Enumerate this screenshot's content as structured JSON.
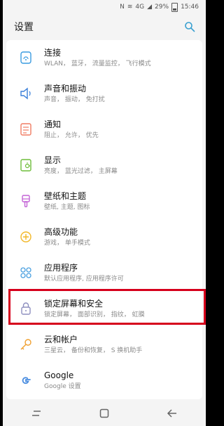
{
  "status": {
    "notif": "N",
    "signal": "4G",
    "battery": "29%",
    "time": "15:46"
  },
  "header": {
    "title": "设置"
  },
  "items": [
    {
      "label": "连接",
      "sub": "WLAN， 蓝牙， 流量监控， 飞行模式",
      "icon": "connection-icon",
      "color": "#3a9be0"
    },
    {
      "label": "声音和振动",
      "sub": "声音， 振动， 免打扰",
      "icon": "sound-icon",
      "color": "#3a7fd9"
    },
    {
      "label": "通知",
      "sub": "阻止， 允许， 优先",
      "icon": "notification-icon",
      "color": "#f07c62"
    },
    {
      "label": "显示",
      "sub": "亮度， 蓝光过滤， 主屏幕",
      "icon": "display-icon",
      "color": "#6ebd3b"
    },
    {
      "label": "壁纸和主题",
      "sub": "壁纸, 主题, 图标",
      "icon": "theme-icon",
      "color": "#c363d6"
    },
    {
      "label": "高级功能",
      "sub": "游戏， 单手模式",
      "icon": "advanced-icon",
      "color": "#f2b829"
    },
    {
      "label": "应用程序",
      "sub": "默认应用程序, 应用程序许可",
      "icon": "apps-icon",
      "color": "#4aa0e0"
    },
    {
      "label": "锁定屏幕和安全",
      "sub": "锁定屏幕， 面部识别， 指纹， 虹膜",
      "icon": "lock-icon",
      "color": "#8d8fbf"
    },
    {
      "label": "云和帐户",
      "sub": "三星云， 备份和恢复， S 换机助手",
      "icon": "key-icon",
      "color": "#f0a030"
    },
    {
      "label": "Google",
      "sub": "Google 设置",
      "icon": "google-icon",
      "color": "#4a8de0"
    }
  ]
}
